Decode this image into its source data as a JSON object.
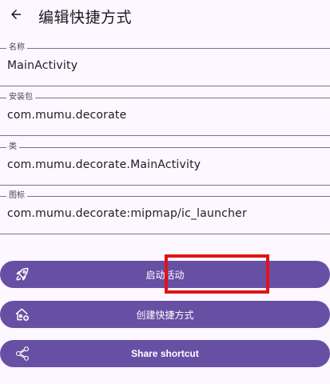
{
  "header": {
    "title": "编辑快捷方式",
    "back_icon": "arrow-left-icon"
  },
  "fields": [
    {
      "label": "名称",
      "value": "MainActivity"
    },
    {
      "label": "安装包",
      "value": "com.mumu.decorate"
    },
    {
      "label": "类",
      "value": "com.mumu.decorate.MainActivity"
    },
    {
      "label": "图标",
      "value": "com.mumu.decorate:mipmap/ic_launcher"
    }
  ],
  "actions": [
    {
      "label": "启动活动",
      "icon": "rocket-icon"
    },
    {
      "label": "创建快捷方式",
      "icon": "add-home-icon"
    },
    {
      "label": "Share shortcut",
      "icon": "share-icon"
    }
  ],
  "colors": {
    "background": "#fdf7ff",
    "primary": "#6750a4",
    "outline": "#79747e",
    "highlight": "#e01414"
  }
}
